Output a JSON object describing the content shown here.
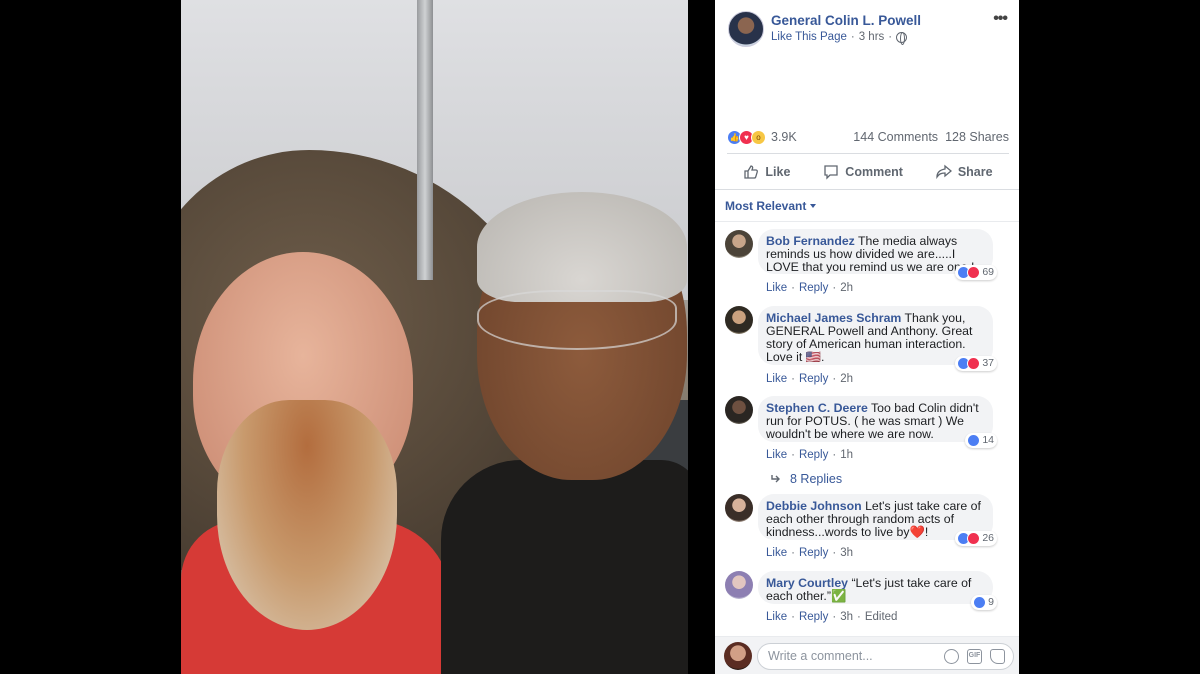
{
  "post": {
    "page_name": "General Colin L. Powell",
    "like_page": "Like This Page",
    "time": "3 hrs",
    "reaction_count": "3.9K",
    "comments_count": "144 Comments",
    "shares_count": "128 Shares"
  },
  "actions": {
    "like": "Like",
    "comment": "Comment",
    "share": "Share"
  },
  "sort_label": "Most Relevant",
  "comments": [
    {
      "author": "Bob Fernandez",
      "text": "The media always reminds us how divided we are.....I LOVE that you remind us we are one !",
      "reactions": "69",
      "like": "Like",
      "reply": "Reply",
      "time": "2h"
    },
    {
      "author": "Michael James Schram",
      "text": "Thank you, GENERAL Powell and Anthony. Great story of American human interaction. Love it 🇺🇸.",
      "reactions": "37",
      "like": "Like",
      "reply": "Reply",
      "time": "2h"
    },
    {
      "author": "Stephen C. Deere",
      "text": "Too bad Colin didn't run for POTUS. ( he was smart ) We wouldn't be where we are now.",
      "reactions": "14",
      "like": "Like",
      "reply": "Reply",
      "time": "1h"
    },
    {
      "author": "Debbie Johnson",
      "text": "Let's just take care of each other through random acts of kindness...words to live by❤️!",
      "reactions": "26",
      "like": "Like",
      "reply": "Reply",
      "time": "3h"
    },
    {
      "author": "Mary Courtley",
      "text": "“Let's just take care of each other.”✅",
      "reactions": "9",
      "like": "Like",
      "reply": "Reply",
      "time": "3h",
      "edited": "Edited"
    }
  ],
  "replies_label": "8 Replies",
  "composer": {
    "placeholder": "Write a comment..."
  },
  "colors": {
    "link": "#385898",
    "like_blue": "#4c7ef3",
    "love_red": "#f0304f",
    "bubble": "#f2f3f5"
  }
}
